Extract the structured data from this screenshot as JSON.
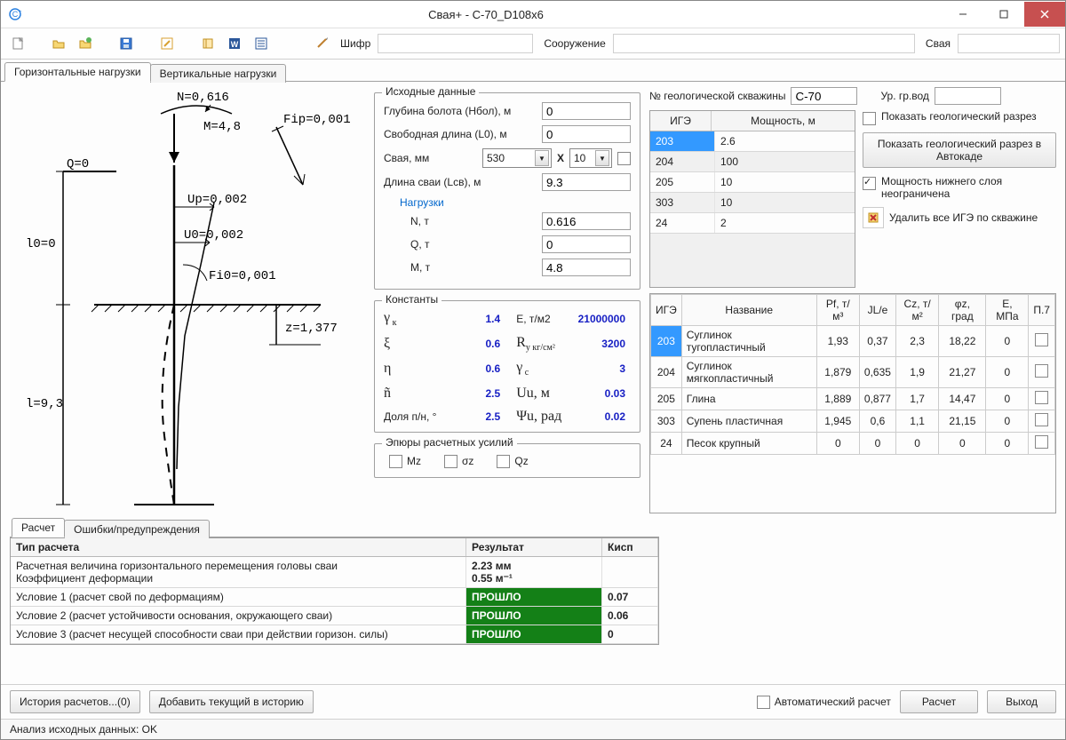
{
  "window": {
    "title": "Свая+ - C-70_D108x6"
  },
  "toolbar": {
    "code_label": "Шифр",
    "code_value": "",
    "struct_label": "Сооружение",
    "struct_value": "",
    "pile_label": "Свая",
    "pile_value": ""
  },
  "main_tabs": {
    "horizontal": "Горизонтальные нагрузки",
    "vertical": "Вертикальные нагрузки"
  },
  "diagram": {
    "N": "N=0,616",
    "M": "M=4,8",
    "Fip": "Fip=0,001",
    "Q": "Q=0",
    "Up": "Up=0,002",
    "U0": "U0=0,002",
    "Fi0": "Fi0=0,001",
    "l0": "l0=0",
    "l": "l=9,3",
    "z": "z=1,377"
  },
  "input": {
    "title": "Исходные данные",
    "swamp_label": "Глубина болота (Нбол), м",
    "swamp": "0",
    "free_label": "Свободная длина (L0), м",
    "free": "0",
    "pile_label": "Свая, мм",
    "pile_size": "530",
    "x": "X",
    "pile_wall": "10",
    "len_label": "Длина сваи (Lсв), м",
    "len": "9.3",
    "loads_link": "Нагрузки",
    "N_label": "N, т",
    "N": "0.616",
    "Q_label": "Q, т",
    "Q": "0",
    "M_label": "M, т",
    "M": "4.8"
  },
  "constants": {
    "title": "Константы",
    "gamma_k": "1.4",
    "E": "21000000",
    "E_lbl": "E, т/м2",
    "xi": "0.6",
    "Ry": "3200",
    "Ry_lbl": "Rу кг/см²",
    "eta": "0.6",
    "gamma_c": "3",
    "n_tilde": "2.5",
    "Uu": "0.03",
    "Uu_lbl": "Uu, м",
    "dolya_lbl": "Доля п/н, °",
    "dolya": "2.5",
    "psi": "0.02",
    "psi_lbl": "Ψu, рад"
  },
  "epury": {
    "title": "Эпюры расчетных усилий",
    "mz": "Mz",
    "sz": "σz",
    "qz": "Qz"
  },
  "geology": {
    "skv_label": "№ геологической скважины",
    "skv": "C-70",
    "gw_label": "Ур. гр.вод",
    "gw": "",
    "col_ige": "ИГЭ",
    "col_thick": "Мощность, м",
    "rows": [
      {
        "ige": "203",
        "thick": "2.6"
      },
      {
        "ige": "204",
        "thick": "100"
      },
      {
        "ige": "205",
        "thick": "10"
      },
      {
        "ige": "303",
        "thick": "10"
      },
      {
        "ige": "24",
        "thick": "2"
      }
    ],
    "show_section": "Показать геологический разрез",
    "show_acad": "Показать геологический разрез в Автокаде",
    "unlimited": "Мощность нижнего слоя неограничена",
    "delete_all": "Удалить все ИГЭ по скважине"
  },
  "soils": {
    "cols": {
      "ige": "ИГЭ",
      "name": "Название",
      "pf": "Pf, т/м³",
      "jle": "JL/e",
      "cz": "Cz, т/м²",
      "phi": "φz, град",
      "e": "E, МПа",
      "p7": "П.7"
    },
    "rows": [
      {
        "ige": "203",
        "name": "Суглинок тугопластичный",
        "pf": "1,93",
        "jle": "0,37",
        "cz": "2,3",
        "phi": "18,22",
        "e": "0"
      },
      {
        "ige": "204",
        "name": "Суглинок мягкопластичный",
        "pf": "1,879",
        "jle": "0,635",
        "cz": "1,9",
        "phi": "21,27",
        "e": "0"
      },
      {
        "ige": "205",
        "name": "Глина",
        "pf": "1,889",
        "jle": "0,877",
        "cz": "1,7",
        "phi": "14,47",
        "e": "0"
      },
      {
        "ige": "303",
        "name": "Супень пластичная",
        "pf": "1,945",
        "jle": "0,6",
        "cz": "1,1",
        "phi": "21,15",
        "e": "0"
      },
      {
        "ige": "24",
        "name": "Песок крупный",
        "pf": "0",
        "jle": "0",
        "cz": "0",
        "phi": "0",
        "e": "0"
      }
    ]
  },
  "results": {
    "tab_calc": "Расчет",
    "tab_err": "Ошибки/предупреждения",
    "col_type": "Тип расчета",
    "col_res": "Результат",
    "col_kisp": "Кисп",
    "row0_type_a": "Расчетная величина горизонтального перемещения головы сваи",
    "row0_type_b": "Коэффициент деформации",
    "row0_res_a": "2.23 мм",
    "row0_res_b": "0.55 м⁻¹",
    "row1_type": "Условие 1 (расчет свой по деформациям)",
    "row1_res": "ПРОШЛО",
    "row1_k": "0.07",
    "row2_type": "Условие 2 (расчет устойчивости основания, окружающего сваи)",
    "row2_res": "ПРОШЛО",
    "row2_k": "0.06",
    "row3_type": "Условие 3 (расчет несущей способности сваи при действии горизон. силы)",
    "row3_res": "ПРОШЛО",
    "row3_k": "0"
  },
  "bottom": {
    "history": "История расчетов...(0)",
    "add_history": "Добавить текущий в историю",
    "auto": "Автоматический расчет",
    "calc": "Расчет",
    "exit": "Выход"
  },
  "status": "Анализ исходных данных: OK"
}
